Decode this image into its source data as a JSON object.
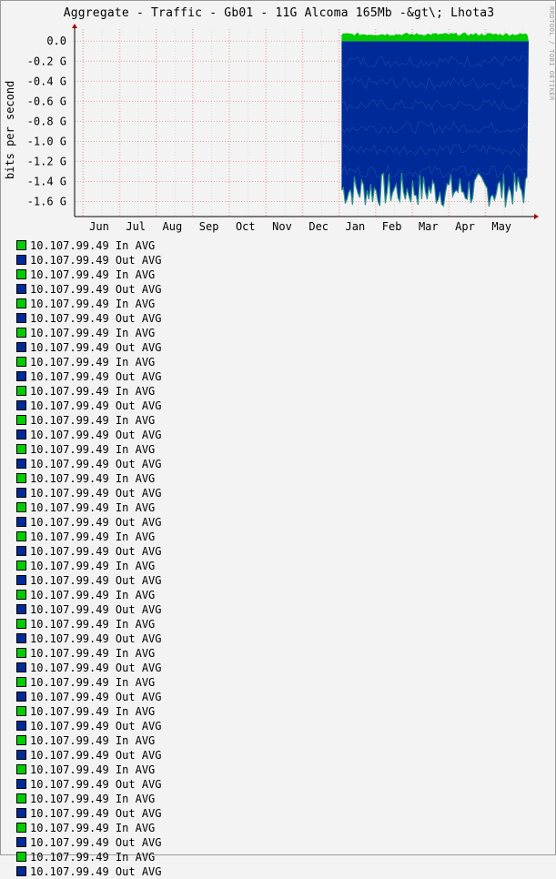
{
  "title": "Aggregate - Traffic - Gb01 - 11G Alcoma 165Mb -&gt\\; Lhota3",
  "watermark": "RRDTOOL / TOBI OETIKER",
  "colors": {
    "in": "#00cc00",
    "out": "#002a97",
    "background": "#f3f3f3",
    "grid": "#ff0000"
  },
  "chart_data": {
    "type": "area",
    "title": "Aggregate - Traffic - Gb01 - 11G Alcoma 165Mb -&gt\\; Lhota3",
    "xlabel": "",
    "ylabel": "bits per second",
    "x_ticks": [
      "Jun",
      "Jul",
      "Aug",
      "Sep",
      "Oct",
      "Nov",
      "Dec",
      "Jan",
      "Feb",
      "Mar",
      "Apr",
      "May"
    ],
    "y_ticks": [
      "0.0",
      "-0.2 G",
      "-0.4 G",
      "-0.6 G",
      "-0.8 G",
      "-1.0 G",
      "-1.2 G",
      "-1.4 G",
      "-1.6 G"
    ],
    "ylim": [
      -1.75,
      0.12
    ],
    "y_unit": "Gbps",
    "grid": true,
    "data_start": "Jan",
    "series": [
      {
        "name": "10.107.99.49 In AVG",
        "role": "in",
        "typical_value": 0.07,
        "color": "#00cc00"
      },
      {
        "name": "10.107.99.49 Out AVG",
        "role": "out",
        "typical_value": -1.45,
        "peak_value": -1.7,
        "color": "#002a97"
      }
    ]
  },
  "legend": [
    {
      "label": "10.107.99.49 In AVG",
      "color": "#00cc00"
    },
    {
      "label": "10.107.99.49 Out AVG",
      "color": "#002a97"
    },
    {
      "label": "10.107.99.49 In AVG",
      "color": "#00cc00"
    },
    {
      "label": "10.107.99.49 Out AVG",
      "color": "#002a97"
    },
    {
      "label": "10.107.99.49 In AVG",
      "color": "#00cc00"
    },
    {
      "label": "10.107.99.49 Out AVG",
      "color": "#002a97"
    },
    {
      "label": "10.107.99.49 In AVG",
      "color": "#00cc00"
    },
    {
      "label": "10.107.99.49 Out AVG",
      "color": "#002a97"
    },
    {
      "label": "10.107.99.49 In AVG",
      "color": "#00cc00"
    },
    {
      "label": "10.107.99.49 Out AVG",
      "color": "#002a97"
    },
    {
      "label": "10.107.99.49 In AVG",
      "color": "#00cc00"
    },
    {
      "label": "10.107.99.49 Out AVG",
      "color": "#002a97"
    },
    {
      "label": "10.107.99.49 In AVG",
      "color": "#00cc00"
    },
    {
      "label": "10.107.99.49 Out AVG",
      "color": "#002a97"
    },
    {
      "label": "10.107.99.49 In AVG",
      "color": "#00cc00"
    },
    {
      "label": "10.107.99.49 Out AVG",
      "color": "#002a97"
    },
    {
      "label": "10.107.99.49 In AVG",
      "color": "#00cc00"
    },
    {
      "label": "10.107.99.49 Out AVG",
      "color": "#002a97"
    },
    {
      "label": "10.107.99.49 In AVG",
      "color": "#00cc00"
    },
    {
      "label": "10.107.99.49 Out AVG",
      "color": "#002a97"
    },
    {
      "label": "10.107.99.49 In AVG",
      "color": "#00cc00"
    },
    {
      "label": "10.107.99.49 Out AVG",
      "color": "#002a97"
    },
    {
      "label": "10.107.99.49 In AVG",
      "color": "#00cc00"
    },
    {
      "label": "10.107.99.49 Out AVG",
      "color": "#002a97"
    },
    {
      "label": "10.107.99.49 In AVG",
      "color": "#00cc00"
    },
    {
      "label": "10.107.99.49 Out AVG",
      "color": "#002a97"
    },
    {
      "label": "10.107.99.49 In AVG",
      "color": "#00cc00"
    },
    {
      "label": "10.107.99.49 Out AVG",
      "color": "#002a97"
    },
    {
      "label": "10.107.99.49 In AVG",
      "color": "#00cc00"
    },
    {
      "label": "10.107.99.49 Out AVG",
      "color": "#002a97"
    },
    {
      "label": "10.107.99.49 In AVG",
      "color": "#00cc00"
    },
    {
      "label": "10.107.99.49 Out AVG",
      "color": "#002a97"
    },
    {
      "label": "10.107.99.49 In AVG",
      "color": "#00cc00"
    },
    {
      "label": "10.107.99.49 Out AVG",
      "color": "#002a97"
    },
    {
      "label": "10.107.99.49 In AVG",
      "color": "#00cc00"
    },
    {
      "label": "10.107.99.49 Out AVG",
      "color": "#002a97"
    },
    {
      "label": "10.107.99.49 In AVG",
      "color": "#00cc00"
    },
    {
      "label": "10.107.99.49 Out AVG",
      "color": "#002a97"
    },
    {
      "label": "10.107.99.49 In AVG",
      "color": "#00cc00"
    },
    {
      "label": "10.107.99.49 Out AVG",
      "color": "#002a97"
    },
    {
      "label": "10.107.99.49 In AVG",
      "color": "#00cc00"
    },
    {
      "label": "10.107.99.49 Out AVG",
      "color": "#002a97"
    },
    {
      "label": "10.107.99.49 In AVG",
      "color": "#00cc00"
    },
    {
      "label": "10.107.99.49 Out AVG",
      "color": "#002a97"
    }
  ]
}
